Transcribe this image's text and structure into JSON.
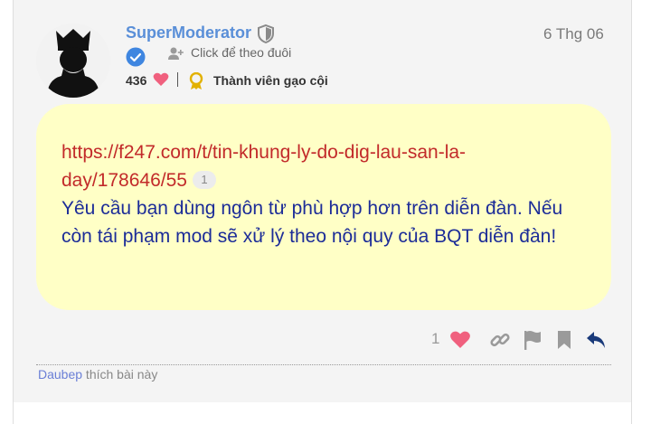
{
  "post": {
    "author": {
      "username": "SuperModerator",
      "follow_label": "Click để theo đuôi",
      "points": "436",
      "rank": "Thành viên gạo cội"
    },
    "date": "6 Thg 06",
    "body": {
      "link_text_line1": "https://f247.com/t/tin-khung-ly-do-dig-lau-san-la-",
      "link_text_line2": "day/178646/55",
      "link_click_count": "1",
      "message": "Yêu cầu bạn dùng ngôn từ phù hợp hơn trên diễn đàn. Nếu còn tái phạm mod sẽ xử lý theo nội quy của BQT diễn đàn!"
    },
    "actions": {
      "like_count": "1"
    },
    "liked_by": {
      "user": "Daubep",
      "suffix": " thích bài này"
    }
  },
  "colors": {
    "username": "#5a8fd8",
    "bubble_bg": "#ffffc6",
    "link": "#c22a2a",
    "message": "#1c2c98",
    "heart": "#f0607e",
    "reply": "#1a3a7a"
  },
  "icons": [
    "moderator-shield-icon",
    "verified-check-icon",
    "follow-user-icon",
    "heart-icon",
    "rank-badge-icon",
    "link-icon",
    "flag-icon",
    "bookmark-icon",
    "reply-icon"
  ]
}
